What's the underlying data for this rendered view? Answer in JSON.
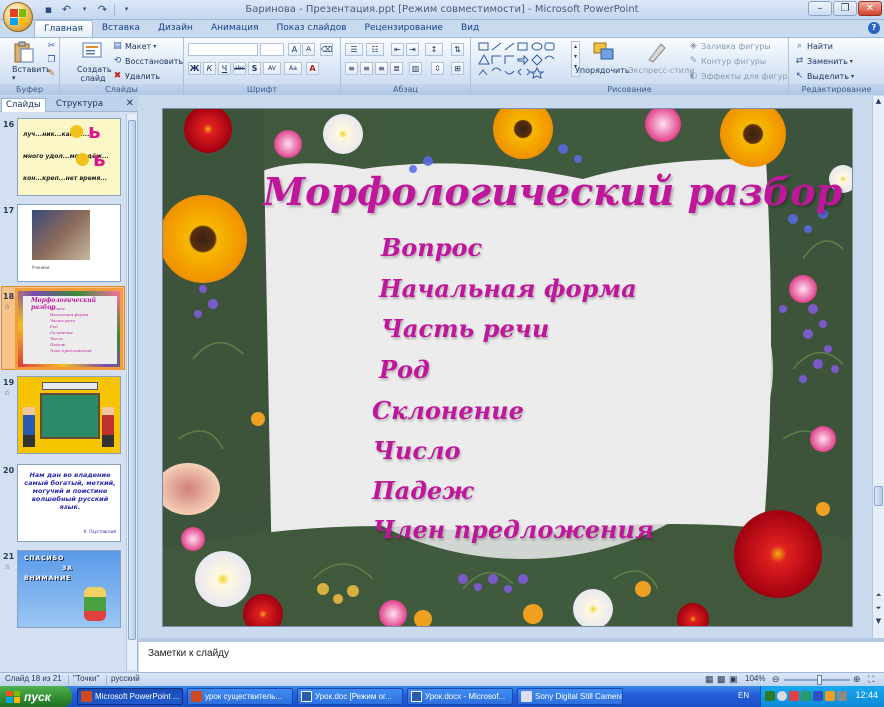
{
  "window": {
    "title": "Баринова - Презентация.ppt [Режим совместимости] - Microsoft PowerPoint"
  },
  "ribbon": {
    "tabs": [
      "Главная",
      "Вставка",
      "Дизайн",
      "Анимация",
      "Показ слайдов",
      "Рецензирование",
      "Вид"
    ],
    "active_tab": "Главная",
    "clipboard": {
      "paste": "Вставить",
      "label": "Буфер обмена"
    },
    "slides": {
      "create": "Создать слайд",
      "layout": "Макет",
      "reset": "Восстановить",
      "delete": "Удалить",
      "label": "Слайды"
    },
    "font": {
      "label": "Шрифт",
      "bold": "Ж",
      "italic": "К",
      "underline": "Ч",
      "strike": "abc",
      "shadow": "S",
      "spacing": "AV",
      "case": "Aa"
    },
    "paragraph": {
      "label": "Абзац"
    },
    "drawing": {
      "arrange": "Упорядочить",
      "quick_styles": "Экспресс-стили",
      "fill": "Заливка фигуры",
      "outline": "Контур фигуры",
      "effects": "Эффекты для фигур",
      "label": "Рисование"
    },
    "editing": {
      "find": "Найти",
      "replace": "Заменить",
      "select": "Выделить",
      "label": "Редактирование"
    }
  },
  "left_panel": {
    "tabs": [
      "Слайды",
      "Структура"
    ],
    "thumbnails": [
      {
        "number": "16",
        "lines": [
          "луч...ник...камен...",
          "много удол...молодёж...",
          "кон...креп...нет время..."
        ]
      },
      {
        "number": "17",
        "caption": "Ученики"
      },
      {
        "number": "18",
        "title": "Морфологический разбор",
        "items": [
          "Вопрос",
          "Начальная форма",
          "Часть речи",
          "Род",
          "Склонение",
          "Число",
          "Падеж",
          "Член предложения"
        ]
      },
      {
        "number": "19"
      },
      {
        "number": "20",
        "text": "Нам дан во владение самый богатый, меткий, могучий и поистине волшебный русский язык.",
        "author": "К. Паустовский"
      },
      {
        "number": "21",
        "text": [
          "СПАСИБО",
          "ЗА",
          "ВНИМАНИЕ"
        ]
      }
    ]
  },
  "slide": {
    "title": "Морфологический разбор",
    "items": [
      "Вопрос",
      "Начальная форма",
      "Часть речи",
      "Род",
      "Склонение",
      "Число",
      "Падеж",
      "Член предложения"
    ],
    "title_color": "#c0169c"
  },
  "notes": {
    "placeholder": "Заметки к слайду"
  },
  "statusbar": {
    "slide_info": "Слайд 18 из 21",
    "theme": "\"Точки\"",
    "language": "русский",
    "zoom": "104%"
  },
  "taskbar": {
    "start": "пуск",
    "tasks": [
      "Microsoft PowerPoint ...",
      "урок существитель...",
      "Урок.doc [Режим ог...",
      "Урок.docx - Microsof...",
      "Sony Digital Still Camera"
    ],
    "language": "EN",
    "clock": "12:44"
  }
}
